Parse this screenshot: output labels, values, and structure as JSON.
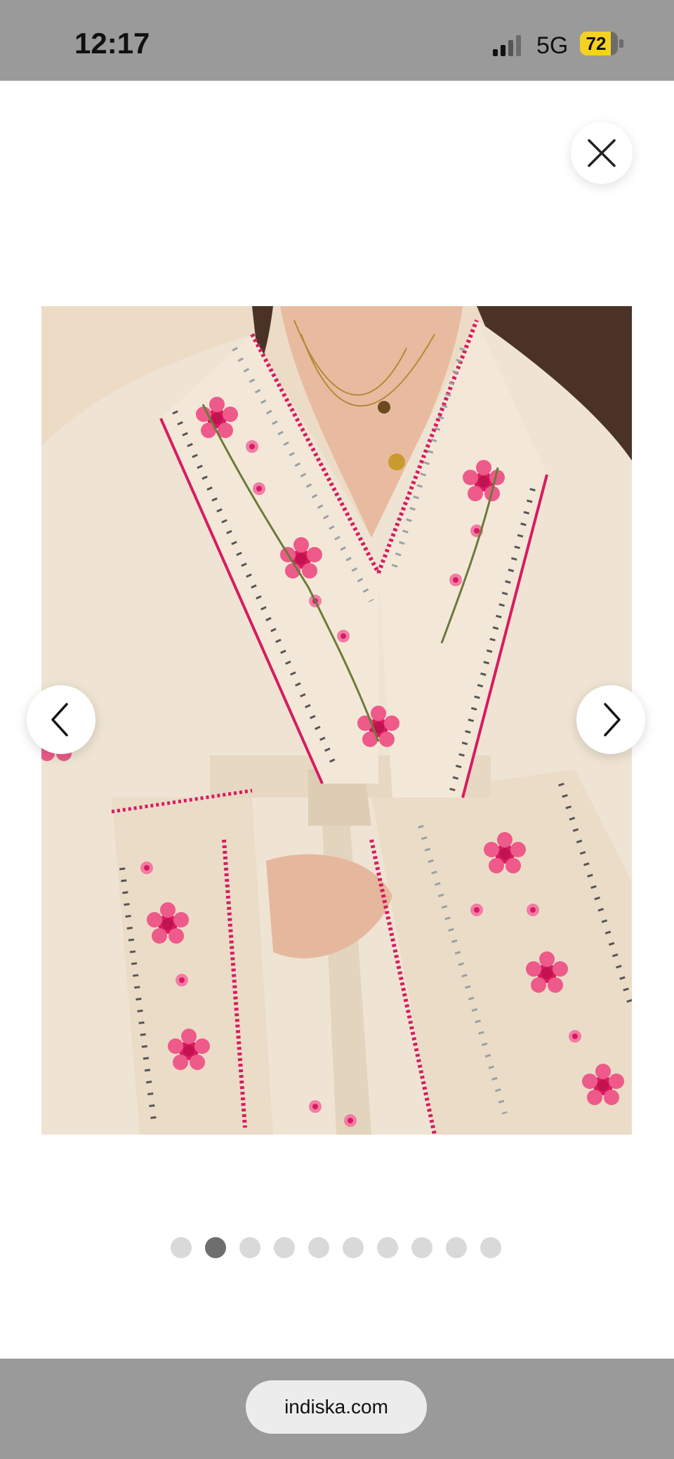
{
  "status_bar": {
    "time": "12:17",
    "network": "5G",
    "battery": "72",
    "battery_color": "#f5d21f"
  },
  "close_button": {
    "icon": "close-icon"
  },
  "gallery": {
    "image_icon": "product-photo",
    "prev_icon": "chevron-left-icon",
    "next_icon": "chevron-right-icon",
    "total_images": 10,
    "active_index": 2
  },
  "address_bar": {
    "url": "indiska.com"
  },
  "colors": {
    "bars": "#9a9a9a",
    "dot_inactive": "#d9d9d9",
    "dot_active": "#6e6e6e",
    "embroidery_pink": "#d81b60",
    "fabric": "#efe4d3"
  }
}
